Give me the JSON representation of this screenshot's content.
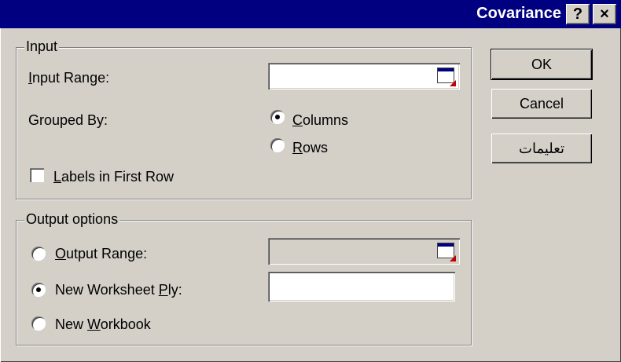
{
  "window": {
    "title": "Covariance",
    "help_button": "?",
    "close_button": "×"
  },
  "input_group": {
    "legend": "Input",
    "input_range": {
      "label_pre": "",
      "label_key": "I",
      "label_post": "nput Range:",
      "value": ""
    },
    "grouped_by_label": "Grouped By:",
    "columns": {
      "label_key": "C",
      "label_post": "olumns",
      "checked": true
    },
    "rows": {
      "label_key": "R",
      "label_post": "ows",
      "checked": false
    },
    "labels_first_row": {
      "label_key": "L",
      "label_post": "abels in First Row",
      "checked": false
    }
  },
  "output_group": {
    "legend": "Output options",
    "output_range": {
      "label_key": "O",
      "label_post": "utput Range:",
      "value": "",
      "checked": false
    },
    "new_sheet": {
      "label_pre": "New Worksheet ",
      "label_key": "P",
      "label_post": "ly:",
      "value": "",
      "checked": true
    },
    "new_workbook": {
      "label_pre": "New ",
      "label_key": "W",
      "label_post": "orkbook",
      "checked": false
    }
  },
  "buttons": {
    "ok": "OK",
    "cancel": "Cancel",
    "help": "تعليمات"
  }
}
